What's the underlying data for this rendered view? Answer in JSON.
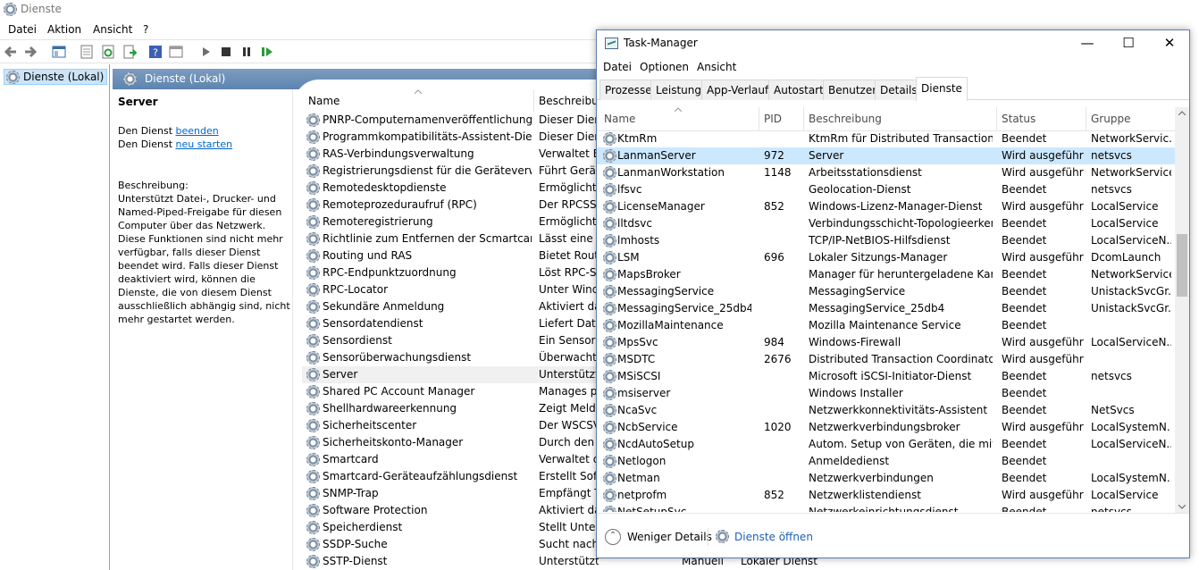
{
  "services_window": {
    "title": "Dienste",
    "menu": [
      "Datei",
      "Aktion",
      "Ansicht",
      "?"
    ],
    "tree_node": "Dienste (Lokal)",
    "content_header": "Dienste (Lokal)",
    "detail": {
      "title": "Server",
      "stop_prefix": "Den Dienst ",
      "stop_link": "beenden",
      "restart_prefix": "Den Dienst ",
      "restart_link": "neu starten",
      "description": "Beschreibung:\nUnterstützt Datei-, Drucker- und Named-Piped-Freigabe für diesen Computer über das Netzwerk. Diese Funktionen sind nicht mehr verfügbar, falls dieser Dienst beendet wird. Falls dieser Dienst deaktiviert wird, können die Dienste, die von diesem Dienst ausschließlich abhängig sind, nicht mehr gestartet werden."
    },
    "columns": [
      "Name",
      "Beschreibung"
    ],
    "rows": [
      {
        "name": "PNRP-Computernamenveröffentlichungs-...",
        "desc": "Dieser Diens"
      },
      {
        "name": "Programmkompatibilitäts-Assistent-Dienst",
        "desc": "Dieser Diens"
      },
      {
        "name": "RAS-Verbindungsverwaltung",
        "desc": "Verwaltet Ei"
      },
      {
        "name": "Registrierungsdienst für die Geräteverwalt...",
        "desc": "Führt Geräte"
      },
      {
        "name": "Remotedesktopdienste",
        "desc": "Ermöglicht E"
      },
      {
        "name": "Remoteprozeduraufruf (RPC)",
        "desc": "Der RPCSS-D"
      },
      {
        "name": "Remoteregistrierung",
        "desc": "Ermöglicht F"
      },
      {
        "name": "Richtlinie zum Entfernen der Scmartcard",
        "desc": "Lässt eine Ko"
      },
      {
        "name": "Routing und RAS",
        "desc": "Bietet Routir"
      },
      {
        "name": "RPC-Endpunktzuordnung",
        "desc": "Löst RPC-Sc"
      },
      {
        "name": "RPC-Locator",
        "desc": "Unter Windo"
      },
      {
        "name": "Sekundäre Anmeldung",
        "desc": "Aktiviert das"
      },
      {
        "name": "Sensordatendienst",
        "desc": "Liefert Dater"
      },
      {
        "name": "Sensordienst",
        "desc": "Ein Sensordi"
      },
      {
        "name": "Sensorüberwachungsdienst",
        "desc": "Überwacht v"
      },
      {
        "name": "Server",
        "desc": "Unterstützt D"
      },
      {
        "name": "Shared PC Account Manager",
        "desc": "Manages pro"
      },
      {
        "name": "Shellhardwareerkennung",
        "desc": "Zeigt Meldu"
      },
      {
        "name": "Sicherheitscenter",
        "desc": "Der WSCSVC"
      },
      {
        "name": "Sicherheitskonto-Manager",
        "desc": "Durch den S"
      },
      {
        "name": "Smartcard",
        "desc": "Verwaltet de"
      },
      {
        "name": "Smartcard-Geräteaufzählungsdienst",
        "desc": "Erstellt Softv"
      },
      {
        "name": "SNMP-Trap",
        "desc": "Empfängt Tr"
      },
      {
        "name": "Software Protection",
        "desc": "Aktiviert das"
      },
      {
        "name": "Speicherdienst",
        "desc": "Stellt Unters"
      },
      {
        "name": "SSDP-Suche",
        "desc": "Sucht nach N"
      },
      {
        "name": "SSTP-Dienst",
        "desc": "Unterstützt SS..."
      }
    ],
    "selected_row": "Server",
    "last_row_extra": {
      "starttyp": "Manuell",
      "anmelden_als": "Lokaler Dienst"
    }
  },
  "task_manager": {
    "title": "Task-Manager",
    "menu": [
      "Datei",
      "Optionen",
      "Ansicht"
    ],
    "tabs": [
      "Prozesse",
      "Leistung",
      "App-Verlauf",
      "Autostart",
      "Benutzer",
      "Details",
      "Dienste"
    ],
    "active_tab": "Dienste",
    "columns": [
      "Name",
      "PID",
      "Beschreibung",
      "Status",
      "Gruppe"
    ],
    "rows": [
      {
        "name": "KtmRm",
        "pid": "",
        "desc": "KtmRm für Distributed Transaction ...",
        "status": "Beendet",
        "group": "NetworkServic..."
      },
      {
        "name": "LanmanServer",
        "pid": "972",
        "desc": "Server",
        "status": "Wird ausgeführt",
        "group": "netsvcs"
      },
      {
        "name": "LanmanWorkstation",
        "pid": "1148",
        "desc": "Arbeitsstationsdienst",
        "status": "Wird ausgeführt",
        "group": "NetworkService"
      },
      {
        "name": "lfsvc",
        "pid": "",
        "desc": "Geolocation-Dienst",
        "status": "Beendet",
        "group": "netsvcs"
      },
      {
        "name": "LicenseManager",
        "pid": "852",
        "desc": "Windows-Lizenz-Manager-Dienst",
        "status": "Wird ausgeführt",
        "group": "LocalService"
      },
      {
        "name": "lltdsvc",
        "pid": "",
        "desc": "Verbindungsschicht-Topologieerken...",
        "status": "Beendet",
        "group": "LocalService"
      },
      {
        "name": "lmhosts",
        "pid": "",
        "desc": "TCP/IP-NetBIOS-Hilfsdienst",
        "status": "Beendet",
        "group": "LocalServiceN..."
      },
      {
        "name": "LSM",
        "pid": "696",
        "desc": "Lokaler Sitzungs-Manager",
        "status": "Wird ausgeführt",
        "group": "DcomLaunch"
      },
      {
        "name": "MapsBroker",
        "pid": "",
        "desc": "Manager für heruntergeladene Karten",
        "status": "Beendet",
        "group": "NetworkService"
      },
      {
        "name": "MessagingService",
        "pid": "",
        "desc": "MessagingService",
        "status": "Beendet",
        "group": "UnistackSvcGr..."
      },
      {
        "name": "MessagingService_25db4",
        "pid": "",
        "desc": "MessagingService_25db4",
        "status": "Beendet",
        "group": "UnistackSvcGr..."
      },
      {
        "name": "MozillaMaintenance",
        "pid": "",
        "desc": "Mozilla Maintenance Service",
        "status": "Beendet",
        "group": ""
      },
      {
        "name": "MpsSvc",
        "pid": "984",
        "desc": "Windows-Firewall",
        "status": "Wird ausgeführt",
        "group": "LocalServiceN..."
      },
      {
        "name": "MSDTC",
        "pid": "2676",
        "desc": "Distributed Transaction Coordinator",
        "status": "Wird ausgeführt",
        "group": ""
      },
      {
        "name": "MSiSCSI",
        "pid": "",
        "desc": "Microsoft iSCSI-Initiator-Dienst",
        "status": "Beendet",
        "group": "netsvcs"
      },
      {
        "name": "msiserver",
        "pid": "",
        "desc": "Windows Installer",
        "status": "Beendet",
        "group": ""
      },
      {
        "name": "NcaSvc",
        "pid": "",
        "desc": "Netzwerkkonnektivitäts-Assistent",
        "status": "Beendet",
        "group": "NetSvcs"
      },
      {
        "name": "NcbService",
        "pid": "1020",
        "desc": "Netzwerkverbindungsbroker",
        "status": "Wird ausgeführt",
        "group": "LocalSystemN..."
      },
      {
        "name": "NcdAutoSetup",
        "pid": "",
        "desc": "Autom. Setup von Geräten, die mit d...",
        "status": "Beendet",
        "group": "LocalServiceN..."
      },
      {
        "name": "Netlogon",
        "pid": "",
        "desc": "Anmeldedienst",
        "status": "Beendet",
        "group": ""
      },
      {
        "name": "Netman",
        "pid": "",
        "desc": "Netzwerkverbindungen",
        "status": "Beendet",
        "group": "LocalSystemN..."
      },
      {
        "name": "netprofm",
        "pid": "852",
        "desc": "Netzwerklistendienst",
        "status": "Wird ausgeführt",
        "group": "LocalService"
      },
      {
        "name": "NetSetupSvc",
        "pid": "",
        "desc": "Netzwerkeinrichtungsdienst",
        "status": "Beendet",
        "group": "netsvcs"
      }
    ],
    "selected_row": "LanmanServer",
    "footer": {
      "fewer_details": "Weniger Details",
      "open_services": "Dienste öffnen"
    }
  }
}
